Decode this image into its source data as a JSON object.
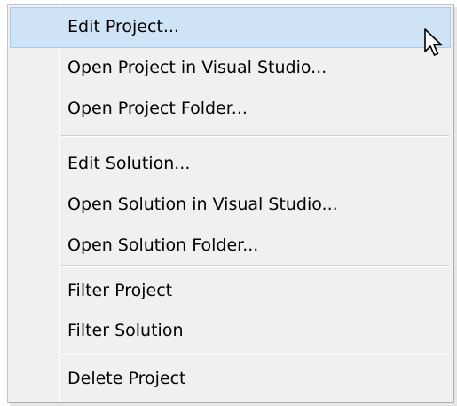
{
  "menu": {
    "items": [
      {
        "label": "Edit Project...",
        "highlighted": true
      },
      {
        "label": "Open Project in Visual Studio..."
      },
      {
        "label": "Open Project Folder..."
      },
      {
        "label": "Edit Solution..."
      },
      {
        "label": "Open Solution in Visual Studio..."
      },
      {
        "label": "Open Solution Folder..."
      },
      {
        "label": "Filter Project"
      },
      {
        "label": "Filter Solution"
      },
      {
        "label": "Delete Project"
      }
    ]
  },
  "colors": {
    "highlight_bg": "#cfe3f7",
    "highlight_border": "#a7cbee",
    "menu_bg": "#f0f0f0"
  },
  "cursor": {
    "icon": "mouse-pointer-icon"
  }
}
